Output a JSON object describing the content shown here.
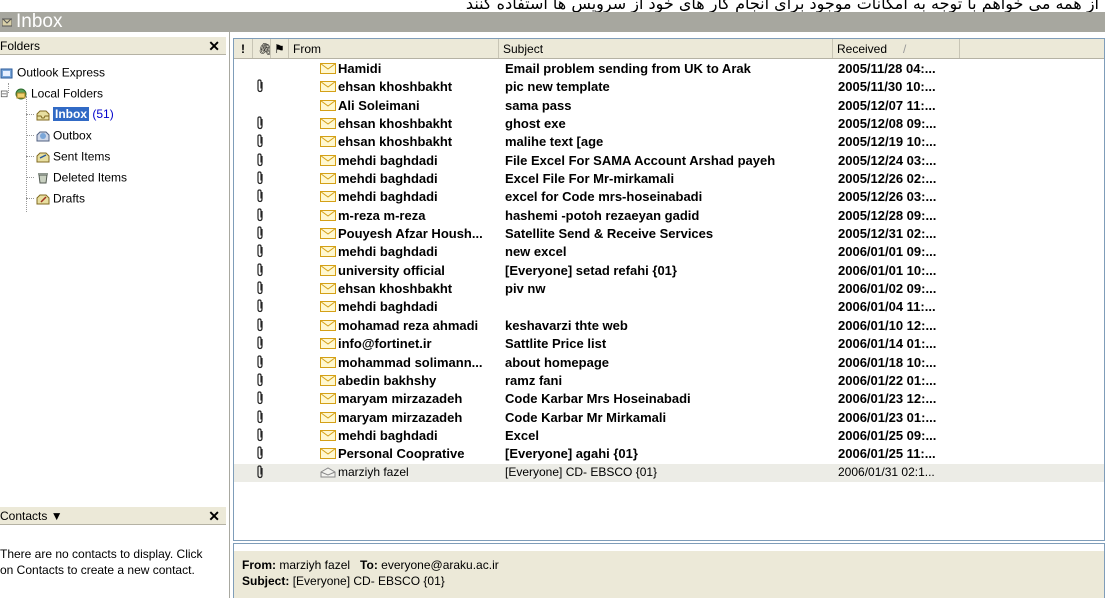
{
  "top_banner_text": "از همه می خواهم با توجه به امکانات موجود برای انجام کار های خود از سرویس ها استفاده کنند",
  "window": {
    "title": "Inbox"
  },
  "folders_pane": {
    "header": "Folders",
    "close_glyph": "✕",
    "items": [
      {
        "label": "Outlook Express",
        "icon": "outlook-express-icon"
      },
      {
        "label": "Local Folders",
        "icon": "local-folders-icon"
      },
      {
        "label": "Inbox",
        "count": "(51)",
        "icon": "inbox-icon"
      },
      {
        "label": "Outbox",
        "icon": "outbox-icon"
      },
      {
        "label": "Sent Items",
        "icon": "sent-items-icon"
      },
      {
        "label": "Deleted Items",
        "icon": "deleted-items-icon"
      },
      {
        "label": "Drafts",
        "icon": "drafts-icon"
      }
    ]
  },
  "contacts_pane": {
    "header": "Contacts ▼",
    "close_glyph": "✕",
    "message_line1": "There are no contacts to display. Click",
    "message_line2": "on Contacts to create a new contact."
  },
  "message_list": {
    "columns": {
      "priority": "!",
      "attachment": "🖇",
      "flag": "⚑",
      "from": "From",
      "subject": "Subject",
      "received": "Received",
      "sort_glyph": "/"
    },
    "rows": [
      {
        "attachment": false,
        "from": "Hamidi",
        "subject": "Email problem sending from UK to Arak",
        "received": "2005/11/28 04:...",
        "read": false
      },
      {
        "attachment": true,
        "from": "ehsan khoshbakht",
        "subject": "pic new template",
        "received": "2005/11/30 10:...",
        "read": false
      },
      {
        "attachment": false,
        "from": "Ali Soleimani",
        "subject": "sama pass",
        "received": "2005/12/07 11:...",
        "read": false
      },
      {
        "attachment": true,
        "from": "ehsan khoshbakht",
        "subject": "ghost exe",
        "received": "2005/12/08 09:...",
        "read": false
      },
      {
        "attachment": true,
        "from": "ehsan khoshbakht",
        "subject": "malihe text [age",
        "received": "2005/12/19 10:...",
        "read": false
      },
      {
        "attachment": true,
        "from": "mehdi baghdadi",
        "subject": "File Excel For SAMA Account Arshad payeh",
        "received": "2005/12/24 03:...",
        "read": false
      },
      {
        "attachment": true,
        "from": "mehdi baghdadi",
        "subject": "Excel File For Mr-mirkamali",
        "received": "2005/12/26 02:...",
        "read": false
      },
      {
        "attachment": true,
        "from": "mehdi baghdadi",
        "subject": "excel for Code mrs-hoseinabadi",
        "received": "2005/12/26 03:...",
        "read": false
      },
      {
        "attachment": true,
        "from": "m-reza m-reza",
        "subject": "hashemi -potoh rezaeyan gadid",
        "received": "2005/12/28 09:...",
        "read": false
      },
      {
        "attachment": true,
        "from": "Pouyesh Afzar Housh...",
        "subject": "Satellite Send & Receive Services",
        "received": "2005/12/31 02:...",
        "read": false
      },
      {
        "attachment": true,
        "from": "mehdi baghdadi",
        "subject": "new excel",
        "received": "2006/01/01 09:...",
        "read": false
      },
      {
        "attachment": true,
        "from": "university official",
        "subject": "[Everyone] setad refahi {01}",
        "received": "2006/01/01 10:...",
        "read": false
      },
      {
        "attachment": true,
        "from": "ehsan khoshbakht",
        "subject": "piv nw",
        "received": "2006/01/02 09:...",
        "read": false
      },
      {
        "attachment": true,
        "from": "mehdi baghdadi",
        "subject": "",
        "received": "2006/01/04 11:...",
        "read": false
      },
      {
        "attachment": true,
        "from": "mohamad reza ahmadi",
        "subject": "keshavarzi thte web",
        "received": "2006/01/10 12:...",
        "read": false
      },
      {
        "attachment": true,
        "from": "info@fortinet.ir",
        "subject": "Sattlite Price list",
        "received": "2006/01/14 01:...",
        "read": false
      },
      {
        "attachment": true,
        "from": "mohammad solimann...",
        "subject": "about homepage",
        "received": "2006/01/18 10:...",
        "read": false
      },
      {
        "attachment": true,
        "from": "abedin bakhshy",
        "subject": "ramz fani",
        "received": "2006/01/22 01:...",
        "read": false
      },
      {
        "attachment": true,
        "from": "maryam mirzazadeh",
        "subject": "Code Karbar Mrs Hoseinabadi",
        "received": "2006/01/23 12:...",
        "read": false
      },
      {
        "attachment": true,
        "from": "maryam mirzazadeh",
        "subject": "Code Karbar Mr Mirkamali",
        "received": "2006/01/23 01:...",
        "read": false
      },
      {
        "attachment": true,
        "from": "mehdi baghdadi",
        "subject": "Excel",
        "received": "2006/01/25 09:...",
        "read": false
      },
      {
        "attachment": true,
        "from": "Personal Cooprative",
        "subject": "[Everyone] agahi {01}",
        "received": "2006/01/25 11:...",
        "read": false
      },
      {
        "attachment": true,
        "from": "marziyh fazel",
        "subject": "[Everyone] CD- EBSCO {01}",
        "received": "2006/01/31 02:1...",
        "read": true
      }
    ]
  },
  "preview": {
    "from_label": "From:",
    "from_value": "marziyh fazel",
    "to_label": "To:",
    "to_value": "everyone@araku.ac.ir",
    "subject_label": "Subject:",
    "subject_value": "[Everyone] CD- EBSCO {01}"
  },
  "colors": {
    "title_bar": "#a7a79f",
    "selection": "#316ac5",
    "header_bg": "#ece9d8",
    "read_row_bg": "#ecece6",
    "envelope_unread": "#d4a017"
  }
}
